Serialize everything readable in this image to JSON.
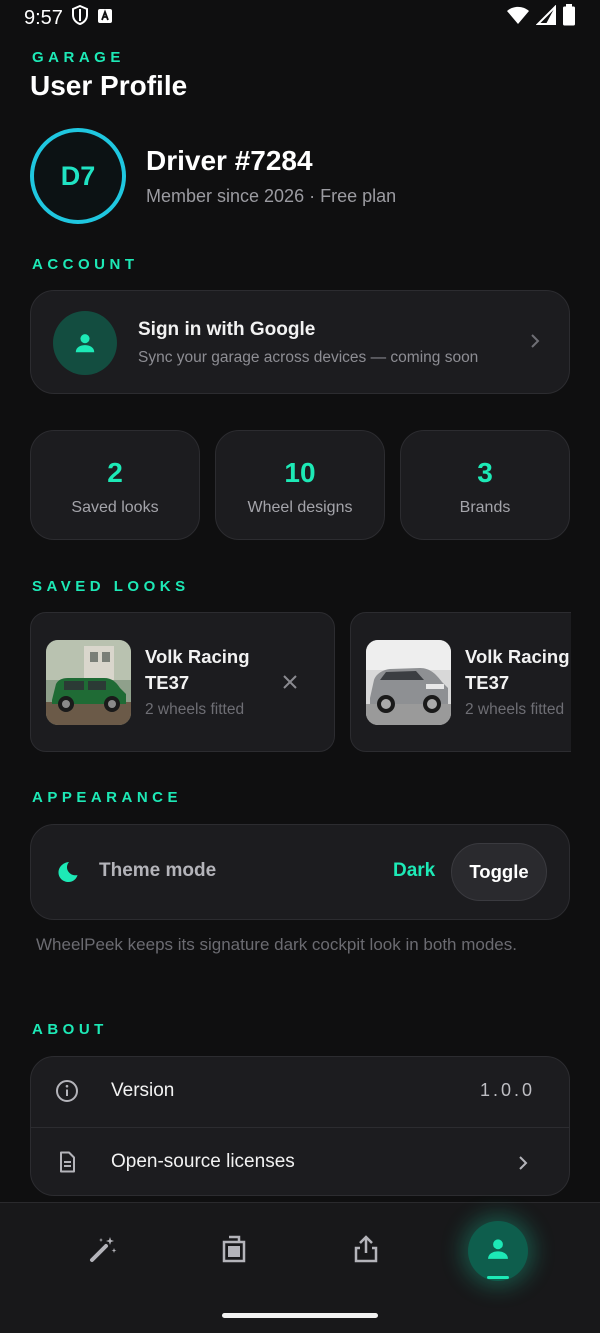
{
  "status_bar": {
    "time": "9:57"
  },
  "header": {
    "eyebrow": "GARAGE",
    "title": "User Profile"
  },
  "profile": {
    "avatar_initials": "D7",
    "name": "Driver #7284",
    "subtitle": "Member since 2026 · Free plan"
  },
  "sections": {
    "account": "ACCOUNT",
    "saved_looks": "SAVED LOOKS",
    "appearance": "APPEARANCE",
    "about": "ABOUT"
  },
  "account": {
    "title": "Sign in with Google",
    "subtitle": "Sync your garage across devices — coming soon"
  },
  "stats": [
    {
      "value": "2",
      "label": "Saved looks"
    },
    {
      "value": "10",
      "label": "Wheel designs"
    },
    {
      "value": "3",
      "label": "Brands"
    }
  ],
  "saved_looks": [
    {
      "title": "Volk Racing TE37",
      "subtitle": "2 wheels fitted"
    },
    {
      "title": "Volk Racing TE37",
      "subtitle": "2 wheels fitted"
    }
  ],
  "appearance": {
    "label": "Theme mode",
    "value": "Dark",
    "button": "Toggle",
    "note": "WheelPeek  keeps its signature dark cockpit look in both modes."
  },
  "about": {
    "version_label": "Version",
    "version_value": "1.0.0",
    "licenses_label": "Open-source licenses"
  },
  "bottom_nav": {
    "items": [
      {
        "icon": "magic-wand-icon"
      },
      {
        "icon": "garage-icon"
      },
      {
        "icon": "share-icon"
      },
      {
        "icon": "profile-icon",
        "active": true
      }
    ]
  },
  "colors": {
    "accent": "#1de9b6",
    "background": "#0f0f10",
    "card": "#1c1c1f",
    "avatar_ring": "#1fc7e0"
  }
}
